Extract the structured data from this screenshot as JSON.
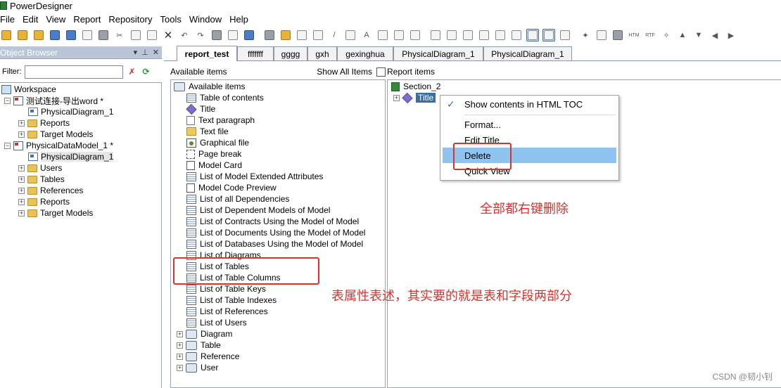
{
  "window": {
    "title": "PowerDesigner"
  },
  "menu": [
    "File",
    "Edit",
    "View",
    "Report",
    "Repository",
    "Tools",
    "Window",
    "Help"
  ],
  "object_browser": {
    "title": "Object Browser",
    "filter_label": "Filter:",
    "filter_value": "",
    "tree": [
      {
        "label": "Workspace",
        "level": 0
      },
      {
        "label": "测试连接-导出word *",
        "level": 1
      },
      {
        "label": "PhysicalDiagram_1",
        "level": 2
      },
      {
        "label": "Reports",
        "level": 2
      },
      {
        "label": "Target Models",
        "level": 2
      },
      {
        "label": "PhysicalDataModel_1 *",
        "level": 1
      },
      {
        "label": "PhysicalDiagram_1",
        "level": 2
      },
      {
        "label": "Users",
        "level": 2
      },
      {
        "label": "Tables",
        "level": 2
      },
      {
        "label": "References",
        "level": 2
      },
      {
        "label": "Reports",
        "level": 2
      },
      {
        "label": "Target Models",
        "level": 2
      }
    ]
  },
  "tabs": [
    "report_test",
    "fffffff",
    "gggg",
    "gxh",
    "gexinghua",
    "PhysicalDiagram_1",
    "PhysicalDiagram_1"
  ],
  "available": {
    "header": "Available items",
    "show_all_label": "Show All Items",
    "show_all_checked": false,
    "items": [
      "Available items",
      "Table of contents",
      "Title",
      "Text paragraph",
      "Text file",
      "Graphical file",
      "Page break",
      "Model Card",
      "List of Model Extended Attributes",
      "Model Code Preview",
      "List of all Dependencies",
      "List of Dependent Models of Model",
      "List of Contracts Using the Model of Model",
      "List of Documents Using the Model of Model",
      "List of Databases Using the Model of Model",
      "List of Diagrams",
      "List of Tables",
      "List of Table Columns",
      "List of Table Keys",
      "List of Table Indexes",
      "List of References",
      "List of Users",
      "Diagram",
      "Table",
      "Reference",
      "User"
    ]
  },
  "report": {
    "header": "Report items",
    "section": "Section_2",
    "title_item": "Title"
  },
  "context_menu": {
    "items": [
      "Show contents in HTML TOC",
      "Format...",
      "Edit Title",
      "Delete",
      "Quick View"
    ],
    "highlighted": "Delete"
  },
  "annotations": {
    "delete_note": "全部都右键删除",
    "tables_note": "表属性表述，其实要的就是表和字段两部分"
  },
  "watermark": "CSDN @韧小钊",
  "colors": {
    "annotation_red": "#e0302a",
    "selection_blue": "#3a6ea5",
    "menu_highlight": "#8fc3f0"
  }
}
